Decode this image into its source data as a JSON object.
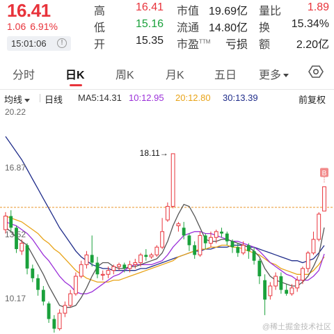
{
  "quote": {
    "price": "16.41",
    "change": "1.06",
    "change_pct": "6.91%",
    "time": "15:01:06",
    "high_label": "高",
    "high": "16.41",
    "low_label": "低",
    "low": "15.16",
    "open_label": "开",
    "open": "15.35",
    "mktcap_label": "市值",
    "mktcap": "19.69亿",
    "float_label": "流通",
    "float": "14.80亿",
    "pe_label": "市盈",
    "pe_tm": "TTM",
    "pe": "亏损",
    "vol_ratio_label": "量比",
    "vol_ratio": "1.89",
    "turnover_label": "换",
    "turnover": "15.34%",
    "amount_label": "额",
    "amount": "2.20亿"
  },
  "tabs": {
    "items": [
      "分时",
      "日K",
      "周K",
      "月K",
      "五日",
      "更多"
    ],
    "active": "日K"
  },
  "controls": {
    "ma_label": "均线",
    "period_label": "日线",
    "ma5": "MA5:14.31",
    "ma10": "10:12.95",
    "ma20": "20:12.80",
    "ma30": "30:13.39",
    "adjust_label": "前复权"
  },
  "colors": {
    "up": "#e8333b",
    "down": "#1aa13b",
    "ma5": "#555555",
    "ma10": "#9b30d9",
    "ma20": "#e8a317",
    "ma30": "#1f2c8a",
    "ref_line": "#e8952a"
  },
  "chart_data": {
    "type": "candlestick",
    "y_ticks": [
      "20.22",
      "16.87",
      "13.52",
      "10.17"
    ],
    "ylim": [
      8.9,
      20.22
    ],
    "reference_price": 15.35,
    "annotation": "18.11→",
    "marker": "B",
    "candles": [
      [
        14.2,
        14.9,
        15.1,
        14.0
      ],
      [
        14.9,
        14.3,
        15.2,
        14.1
      ],
      [
        14.3,
        13.2,
        14.4,
        13.0
      ],
      [
        13.1,
        13.5,
        13.7,
        12.9
      ],
      [
        13.4,
        12.2,
        13.5,
        11.9
      ],
      [
        12.2,
        11.7,
        12.4,
        11.5
      ],
      [
        11.7,
        11.1,
        11.9,
        10.8
      ],
      [
        11.1,
        10.5,
        11.3,
        10.3
      ],
      [
        10.4,
        9.6,
        10.5,
        9.4
      ],
      [
        9.6,
        9.1,
        9.8,
        8.9
      ],
      [
        9.1,
        9.9,
        10.1,
        9.0
      ],
      [
        9.9,
        10.3,
        10.5,
        9.7
      ],
      [
        10.3,
        10.9,
        11.1,
        10.2
      ],
      [
        10.9,
        11.8,
        12.0,
        10.8
      ],
      [
        11.8,
        12.4,
        12.6,
        11.7
      ],
      [
        12.4,
        12.9,
        13.1,
        12.2
      ],
      [
        12.9,
        12.5,
        13.9,
        12.3
      ],
      [
        12.5,
        11.9,
        12.8,
        11.7
      ],
      [
        11.9,
        11.9,
        12.1,
        11.6
      ],
      [
        11.9,
        12.1,
        12.3,
        11.7
      ],
      [
        12.1,
        12.3,
        12.4,
        11.9
      ],
      [
        12.3,
        12.4,
        12.5,
        12.1
      ],
      [
        12.4,
        12.2,
        12.5,
        12.0
      ],
      [
        12.2,
        12.4,
        12.6,
        12.0
      ],
      [
        12.4,
        12.5,
        12.7,
        12.2
      ],
      [
        12.5,
        12.9,
        13.0,
        12.3
      ],
      [
        12.9,
        12.8,
        13.2,
        12.6
      ],
      [
        12.8,
        12.9,
        13.0,
        12.7
      ],
      [
        12.9,
        13.3,
        13.4,
        12.8
      ],
      [
        13.3,
        14.1,
        14.8,
        13.2
      ],
      [
        14.7,
        15.4,
        15.6,
        14.6
      ],
      [
        15.4,
        18.11,
        18.11,
        15.3
      ],
      [
        14.4,
        14.5,
        14.6,
        14.1
      ],
      [
        14.3,
        13.9,
        14.6,
        13.7
      ],
      [
        13.9,
        13.4,
        14.0,
        13.1
      ],
      [
        13.4,
        12.9,
        13.6,
        12.7
      ],
      [
        12.9,
        13.9,
        14.1,
        12.8
      ],
      [
        13.9,
        13.5,
        14.0,
        13.2
      ],
      [
        13.5,
        13.8,
        14.1,
        13.3
      ],
      [
        13.8,
        14.1,
        14.2,
        13.5
      ],
      [
        14.1,
        14.0,
        14.3,
        13.8
      ],
      [
        14.0,
        13.6,
        14.1,
        13.4
      ],
      [
        13.6,
        13.3,
        13.7,
        13.0
      ],
      [
        13.3,
        13.0,
        13.5,
        12.8
      ],
      [
        13.0,
        13.4,
        13.6,
        12.9
      ],
      [
        13.4,
        13.1,
        13.5,
        12.7
      ],
      [
        13.1,
        12.6,
        13.3,
        12.4
      ],
      [
        12.6,
        11.8,
        12.7,
        11.4
      ],
      [
        11.6,
        10.6,
        11.9,
        9.8
      ],
      [
        10.8,
        11.3,
        11.5,
        10.6
      ],
      [
        11.3,
        11.8,
        12.0,
        11.1
      ],
      [
        11.8,
        11.1,
        12.0,
        10.9
      ],
      [
        11.1,
        10.9,
        11.4,
        10.8
      ],
      [
        10.9,
        11.2,
        11.4,
        10.8
      ],
      [
        11.2,
        11.6,
        11.8,
        11.0
      ],
      [
        11.6,
        12.2,
        12.3,
        11.4
      ],
      [
        12.2,
        13.0,
        13.1,
        12.0
      ],
      [
        13.0,
        13.7,
        14.1,
        12.9
      ],
      [
        13.7,
        15.0,
        15.1,
        13.6
      ],
      [
        15.16,
        16.41,
        16.41,
        15.16
      ]
    ],
    "ma5": [
      14.3,
      14.1,
      13.8,
      13.6,
      13.4,
      12.9,
      12.4,
      11.9,
      11.3,
      10.8,
      10.3,
      10.2,
      10.2,
      10.3,
      10.7,
      11.2,
      11.8,
      12.3,
      12.5,
      12.5,
      12.3,
      12.2,
      12.2,
      12.3,
      12.3,
      12.4,
      12.5,
      12.6,
      12.7,
      13.0,
      13.6,
      14.4,
      15.0,
      15.5,
      15.4,
      14.9,
      14.3,
      13.7,
      13.6,
      13.6,
      13.7,
      13.7,
      13.6,
      13.5,
      13.4,
      13.3,
      13.1,
      12.8,
      12.2,
      11.8,
      11.6,
      11.5,
      11.4,
      11.3,
      11.3,
      11.5,
      11.8,
      12.3,
      12.9,
      14.31
    ],
    "ma10": [
      14.6,
      14.5,
      14.4,
      14.2,
      14.0,
      13.7,
      13.3,
      12.9,
      12.6,
      12.2,
      11.8,
      11.5,
      11.3,
      11.0,
      10.9,
      10.9,
      11.0,
      11.2,
      11.4,
      11.6,
      11.8,
      11.9,
      12.1,
      12.3,
      12.4,
      12.4,
      12.4,
      12.4,
      12.5,
      12.6,
      12.9,
      13.3,
      13.6,
      13.9,
      14.0,
      14.1,
      14.1,
      14.0,
      14.0,
      13.9,
      13.8,
      13.7,
      13.6,
      13.6,
      13.5,
      13.4,
      13.3,
      13.1,
      12.8,
      12.5,
      12.3,
      12.1,
      11.9,
      11.8,
      11.6,
      11.6,
      11.6,
      11.8,
      12.1,
      12.95
    ],
    "ma20": [
      14.9,
      14.8,
      14.7,
      14.6,
      14.4,
      14.2,
      14.0,
      13.7,
      13.5,
      13.2,
      13.0,
      12.7,
      12.4,
      12.1,
      11.9,
      11.7,
      11.6,
      11.5,
      11.5,
      11.5,
      11.6,
      11.6,
      11.7,
      11.8,
      11.9,
      12.0,
      12.1,
      12.2,
      12.3,
      12.4,
      12.5,
      12.6,
      12.8,
      12.9,
      13.0,
      13.1,
      13.2,
      13.2,
      13.3,
      13.3,
      13.4,
      13.4,
      13.3,
      13.3,
      13.2,
      13.1,
      13.0,
      12.9,
      12.7,
      12.5,
      12.4,
      12.2,
      12.1,
      12.0,
      11.9,
      11.9,
      11.9,
      12.1,
      12.4,
      12.8
    ],
    "ma30": [
      19.0,
      18.6,
      18.2,
      17.8,
      17.3,
      16.8,
      16.3,
      15.8,
      15.3,
      14.8,
      14.3,
      13.9,
      13.5,
      13.1,
      12.8,
      12.6,
      12.4,
      12.3,
      12.2,
      12.2,
      12.1,
      12.1,
      12.1,
      12.1,
      12.1,
      12.2,
      12.2,
      12.3,
      12.4,
      12.5,
      12.6,
      12.7,
      12.8,
      12.9,
      13.0,
      13.1,
      13.1,
      13.2,
      13.2,
      13.3,
      13.3,
      13.3,
      13.4,
      13.4,
      13.4,
      13.3,
      13.3,
      13.2,
      13.1,
      13.0,
      12.9,
      12.8,
      12.7,
      12.6,
      12.6,
      12.5,
      12.6,
      12.7,
      13.0,
      13.39
    ]
  },
  "watermark": "@稀土掘金技术社区"
}
